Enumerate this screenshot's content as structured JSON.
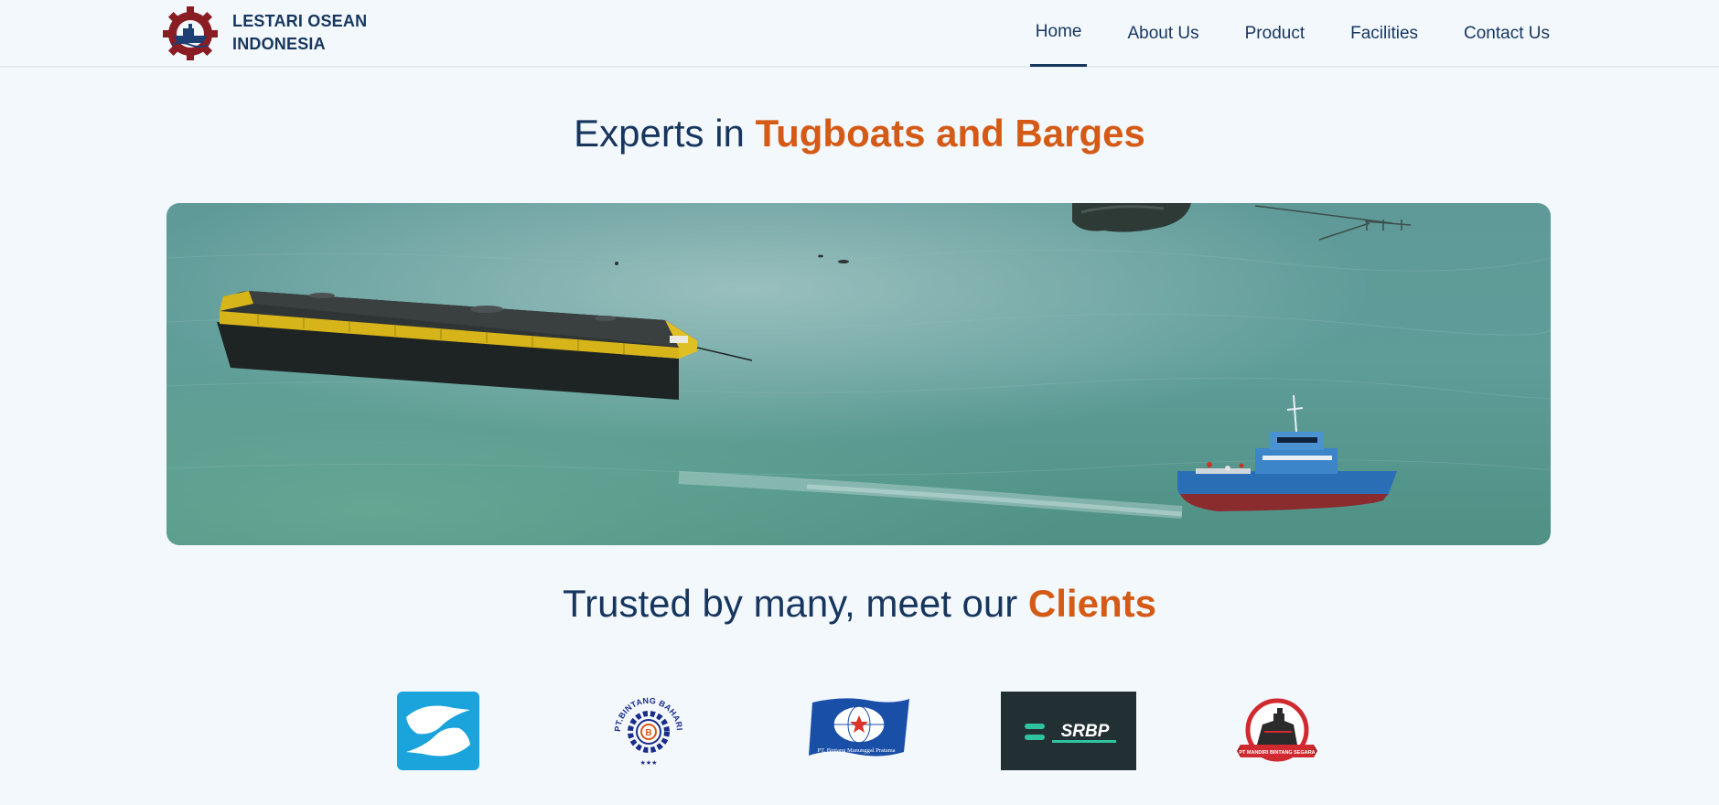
{
  "brand": {
    "line1": "LESTARI OSEAN",
    "line2": "INDONESIA"
  },
  "nav": {
    "items": [
      {
        "label": "Home",
        "active": true
      },
      {
        "label": "About Us"
      },
      {
        "label": "Product"
      },
      {
        "label": "Facilities"
      },
      {
        "label": "Contact Us"
      }
    ]
  },
  "hero": {
    "title_plain": "Experts in ",
    "title_accent": "Tugboats and Barges"
  },
  "clients": {
    "title_plain": "Trusted by many, meet our ",
    "title_accent": "Clients",
    "logos": [
      {
        "name": "client-s-logo"
      },
      {
        "name": "client-bintang-bahari-logo",
        "text": "PT.BINTANG BAHARI MARITIM"
      },
      {
        "name": "client-bintang-manunggal-logo",
        "text": "PT. Bintang Manunggal Pratama"
      },
      {
        "name": "client-srbp-logo",
        "text": "SRBP"
      },
      {
        "name": "client-mandiri-bintang-logo",
        "text": "PT MANDIRI BINTANG SEGARA"
      }
    ]
  },
  "colors": {
    "navy": "#17365e",
    "accent": "#d45a16",
    "background": "#f3f8fd"
  }
}
